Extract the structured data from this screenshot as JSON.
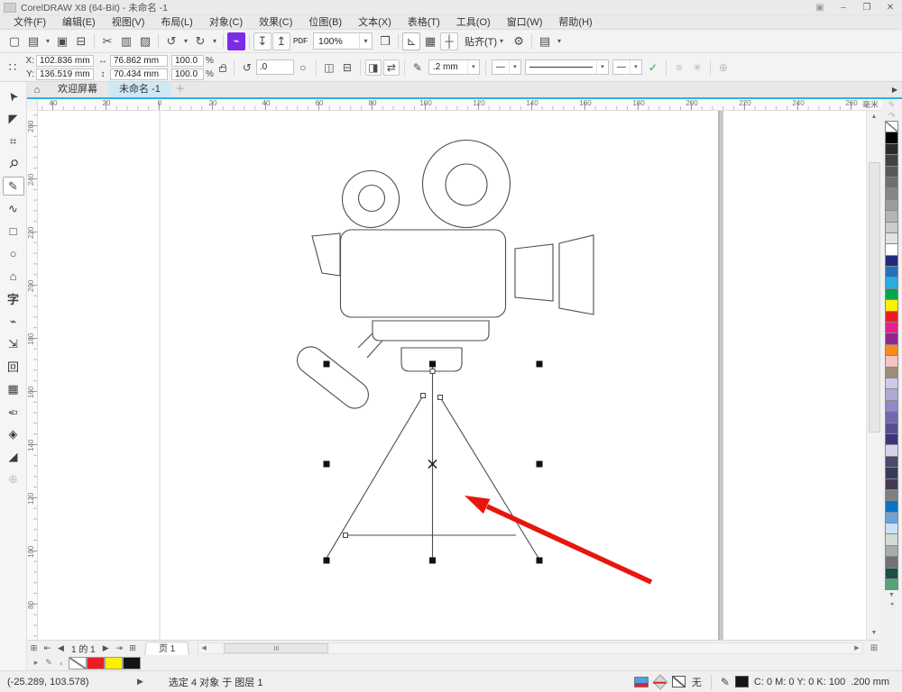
{
  "window": {
    "title": "CorelDRAW X8 (64-Bit) - 未命名 -1",
    "minimize_glyph": "–",
    "restore_glyph": "❐",
    "close_glyph": "✕",
    "signin_glyph": "▣"
  },
  "menubar": [
    {
      "name": "menu-file",
      "label": "文件(F)"
    },
    {
      "name": "menu-edit",
      "label": "编辑(E)"
    },
    {
      "name": "menu-view",
      "label": "视图(V)"
    },
    {
      "name": "menu-layout",
      "label": "布局(L)"
    },
    {
      "name": "menu-object",
      "label": "对象(C)"
    },
    {
      "name": "menu-effects",
      "label": "效果(C)"
    },
    {
      "name": "menu-bitmaps",
      "label": "位图(B)"
    },
    {
      "name": "menu-text",
      "label": "文本(X)"
    },
    {
      "name": "menu-table",
      "label": "表格(T)"
    },
    {
      "name": "menu-tools",
      "label": "工具(O)"
    },
    {
      "name": "menu-window",
      "label": "窗口(W)"
    },
    {
      "name": "menu-help",
      "label": "帮助(H)"
    }
  ],
  "toolbar": {
    "zoom_value": "100%",
    "snap_label": "贴齐(T)",
    "caret": "▾",
    "items_a": [
      {
        "name": "new-document-button",
        "glyph": "▢"
      },
      {
        "name": "open-button",
        "glyph": "▤"
      },
      {
        "name": "open-caret",
        "glyph": "▾",
        "cls": "caret"
      },
      {
        "name": "save-button",
        "glyph": "▣"
      },
      {
        "name": "print-button",
        "glyph": "⊟"
      },
      {
        "name": "separator",
        "glyph": "",
        "cls": "sep"
      },
      {
        "name": "cut-button",
        "glyph": "✂"
      },
      {
        "name": "copy-button",
        "glyph": "▥"
      },
      {
        "name": "paste-button",
        "glyph": "▨"
      },
      {
        "name": "separator",
        "glyph": "",
        "cls": "sep"
      },
      {
        "name": "undo-button",
        "glyph": "↺"
      },
      {
        "name": "undo-caret",
        "glyph": "▾",
        "cls": "caret"
      },
      {
        "name": "redo-button",
        "glyph": "↻"
      },
      {
        "name": "redo-caret",
        "glyph": "▾",
        "cls": "caret"
      },
      {
        "name": "separator",
        "glyph": "",
        "cls": "sep"
      },
      {
        "name": "search-content-button",
        "glyph": "⌁",
        "cls": "purple"
      },
      {
        "name": "separator",
        "glyph": "",
        "cls": "sep"
      },
      {
        "name": "import-button",
        "glyph": "↧",
        "cls": "boxed"
      },
      {
        "name": "export-button",
        "glyph": "↥",
        "cls": "boxed"
      },
      {
        "name": "publish-pdf-button",
        "glyph": "PDF",
        "cls": "pdf"
      }
    ],
    "items_b": [
      {
        "name": "fullscreen-button",
        "glyph": "❒"
      },
      {
        "name": "separator",
        "glyph": "",
        "cls": "sep"
      },
      {
        "name": "show-rulers-button",
        "glyph": "⊾",
        "cls": "on"
      },
      {
        "name": "show-grid-button",
        "glyph": "▦"
      },
      {
        "name": "show-guidelines-button",
        "glyph": "┼",
        "cls": "boxed"
      }
    ],
    "items_c": [
      {
        "name": "options-button",
        "glyph": "⚙"
      },
      {
        "name": "separator",
        "glyph": "",
        "cls": "sep"
      },
      {
        "name": "panels-button",
        "glyph": "▤"
      },
      {
        "name": "panels-caret",
        "glyph": "▾",
        "cls": "caret"
      }
    ]
  },
  "propbar": {
    "x_label": "X:",
    "x_value": "102.836 mm",
    "y_label": "Y:",
    "y_value": "136.519 mm",
    "width_icon": "↔",
    "width_value": "76.862 mm",
    "height_icon": "↕",
    "height_value": "70.434 mm",
    "scale_h": "100.0",
    "scale_v": "100.0",
    "percent": "%",
    "rotate_icon": "↺",
    "angle_value": ".0",
    "dial_icon": "○",
    "mirror_h_glyph": "◫",
    "mirror_v_glyph": "⊟",
    "transform1_glyph": "◨",
    "transform2_glyph": "⇄",
    "curves_glyph": "⌖",
    "close_curve_glyph": "✎",
    "nib_glyph": "✎",
    "outline_width": ".2 mm",
    "arrow_start": "—",
    "arrow_end": "—",
    "wrap_glyph": "✓",
    "align_glyph": "≡",
    "position_glyph": "✳",
    "preset_glyph": "⊕"
  },
  "tabs": {
    "home_glyph": "⌂",
    "items": [
      {
        "name": "tab-welcome",
        "label": "欢迎屏幕",
        "active": ""
      },
      {
        "name": "tab-untitled",
        "label": "未命名 -1",
        "active": "active"
      }
    ],
    "new_glyph": "＋",
    "scroll_glyph": "▶"
  },
  "ruler": {
    "unit": "毫米",
    "h_labels": [
      "40",
      "20",
      "0",
      "20",
      "40",
      "60",
      "80",
      "100",
      "120",
      "140",
      "160",
      "180",
      "200",
      "220",
      "240",
      "260"
    ],
    "v_labels": [
      "260",
      "240",
      "220",
      "200",
      "180",
      "160",
      "140",
      "120",
      "100",
      "80"
    ]
  },
  "toolbox": [
    {
      "name": "pick-tool",
      "glyph": "➤",
      "cls": "rotm125"
    },
    {
      "name": "shape-tool",
      "glyph": "◤"
    },
    {
      "name": "crop-tool",
      "glyph": "⌗"
    },
    {
      "name": "zoom-tool",
      "glyph": "⚲",
      "cls": "rot45"
    },
    {
      "name": "pen-tool",
      "glyph": "✎",
      "cls": "active"
    },
    {
      "name": "bspline-tool",
      "glyph": "∿"
    },
    {
      "name": "rectangle-tool",
      "glyph": "□"
    },
    {
      "name": "ellipse-tool",
      "glyph": "○"
    },
    {
      "name": "polygon-tool",
      "glyph": "⌂"
    },
    {
      "name": "text-tool",
      "glyph": "字",
      "cls": "tool-zi"
    },
    {
      "name": "connector-tool",
      "glyph": "⌁"
    },
    {
      "name": "dimension-tool",
      "glyph": "⇲"
    },
    {
      "name": "contour-tool",
      "glyph": "回"
    },
    {
      "name": "mesh-fill-tool",
      "glyph": "▦"
    },
    {
      "name": "eyedropper-tool",
      "glyph": "✑",
      "cls": "rot180"
    },
    {
      "name": "smart-fill-tool",
      "glyph": "◈"
    },
    {
      "name": "fill-tool",
      "glyph": "◢"
    },
    {
      "name": "add-tool-button",
      "glyph": "⊕",
      "cls": "faded"
    }
  ],
  "palette": {
    "scroll_up": "▲",
    "scroll_down": "▼",
    "flyout": "◂",
    "option_icons": [
      "✎",
      "↷"
    ],
    "colors": [
      "none",
      "#000000",
      "#2b2b2b",
      "#424242",
      "#595959",
      "#6f6f6f",
      "#868686",
      "#9d9d9d",
      "#b4b4b4",
      "#cbcbcb",
      "#e2e2e2",
      "#ffffff",
      "#1f2a7e",
      "#1e73be",
      "#2aabe2",
      "#00a550",
      "#ffef00",
      "#ed1c24",
      "#ea1c8d",
      "#90278e",
      "#f68b1f",
      "#f5c3c1",
      "#9c8d7c",
      "#cfc8e8",
      "#b3a7d8",
      "#9488c4",
      "#7568ad",
      "#5a4d96",
      "#403378",
      "#d8d3ec",
      "#4a4a6e",
      "#39395a",
      "#473a55",
      "#7e8082",
      "#0d72c7",
      "#6ba4d9",
      "#c6e2f9",
      "#d2dcd4",
      "#a9acae",
      "#707274",
      "#1f4f44",
      "#57a378"
    ]
  },
  "pagebar": {
    "add_page_glyph": "⊞",
    "first_glyph": "⇤",
    "prev_glyph": "◀",
    "counter": "1 的 1",
    "next_glyph": "▶",
    "last_glyph": "⇥",
    "page_tab": "页 1",
    "hscroll_left": "◀",
    "hscroll_right": "▶",
    "navigator_glyph": "⊞"
  },
  "docpalette": {
    "flyout_glyph": "▸",
    "eyedropper_glyph": "✎",
    "scroll_glyph": "‹",
    "colors": [
      "none",
      "#ed1c24",
      "#ffef00",
      "#141414"
    ]
  },
  "statusbar": {
    "coords": "(-25.289, 103.578)",
    "expand_glyph": "▶",
    "selection": "选定 4 对象 于 图层 1",
    "fill_none_label": "无",
    "pen_glyph": "✎",
    "outline_cmyk": "C: 0 M: 0 Y: 0 K: 100",
    "outline_width": ".200 mm"
  },
  "colors": {
    "accent_blue": "#2bb3e8",
    "arrow_red": "#e8150d",
    "drawing_stroke": "#4d4d4d"
  }
}
